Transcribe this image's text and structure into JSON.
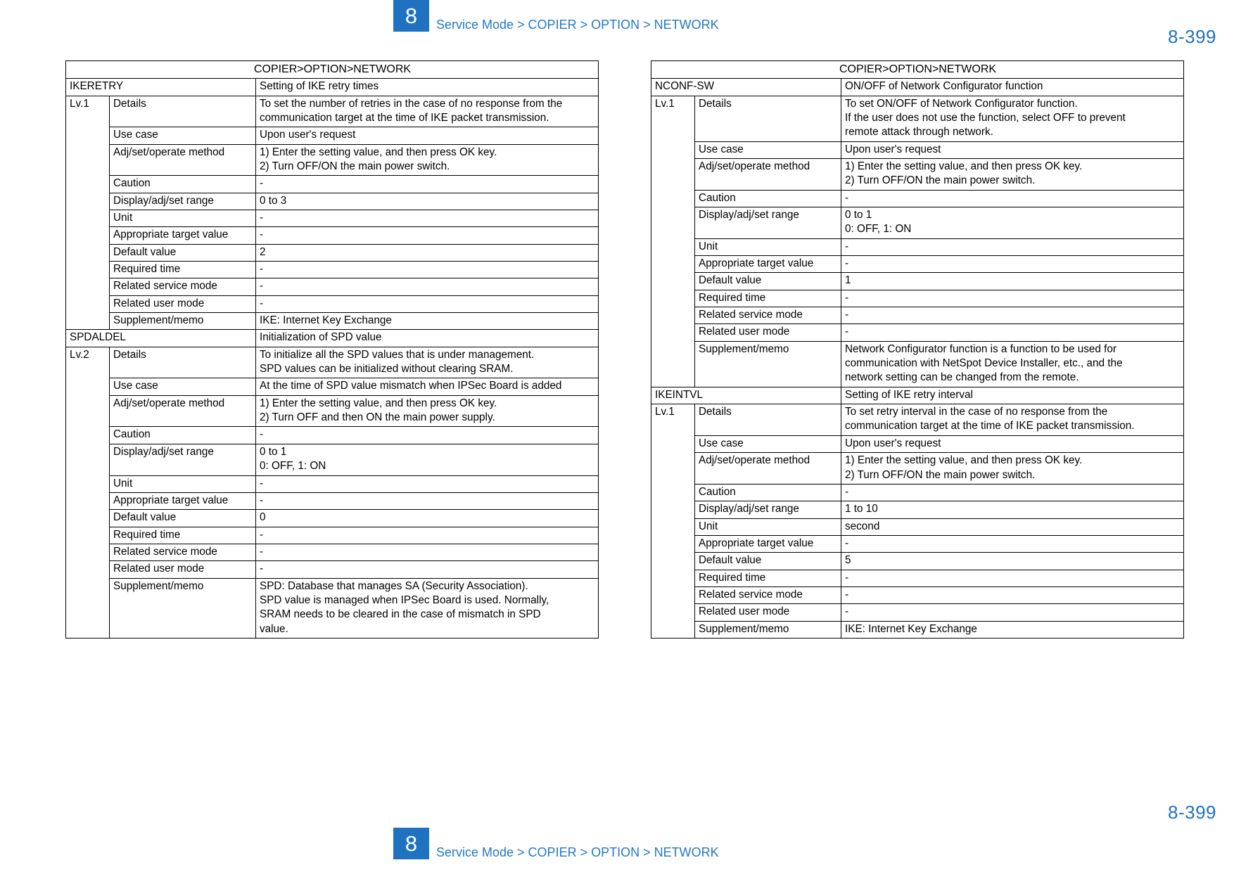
{
  "header": {
    "chapter": "8",
    "breadcrumb": "Service Mode > COPIER > OPTION > NETWORK",
    "page_number": "8-399"
  },
  "footer": {
    "chapter": "8",
    "breadcrumb": "Service Mode > COPIER > OPTION > NETWORK",
    "page_number": "8-399"
  },
  "colors": {
    "accent": "#1F72C0",
    "title_band": "#A7C0E4",
    "label_cell": "#D6DFF2"
  },
  "labels": {
    "details": "Details",
    "use_case": "Use case",
    "method": "Adj/set/operate method",
    "caution": "Caution",
    "range": "Display/adj/set range",
    "unit": "Unit",
    "target": "Appropriate target value",
    "default": "Default value",
    "required_time": "Required time",
    "related_service": "Related service mode",
    "related_user": "Related user mode",
    "supplement": "Supplement/memo"
  },
  "left_table": {
    "title": "COPIER>OPTION>NETWORK",
    "items": [
      {
        "code": "IKERETRY",
        "desc": "Setting of IKE retry times",
        "level": "Lv.1",
        "details": [
          "To set the number of retries in the case of no response from the",
          "communication target at the time of IKE packet transmission."
        ],
        "use_case": [
          "Upon user's request"
        ],
        "method": [
          "1) Enter the setting value, and then press OK key.",
          "2) Turn OFF/ON the main power switch."
        ],
        "caution": [
          "-"
        ],
        "range": [
          "0 to 3"
        ],
        "unit": [
          "-"
        ],
        "target": [
          "-"
        ],
        "default": [
          "2"
        ],
        "required_time": [
          "-"
        ],
        "related_service": [
          "-"
        ],
        "related_user": [
          "-"
        ],
        "supplement": [
          "IKE: Internet Key Exchange"
        ]
      },
      {
        "code": "SPDALDEL",
        "desc": "Initialization of SPD value",
        "level": "Lv.2",
        "details": [
          "To initialize all the SPD values that is under management.",
          "SPD values can be initialized without clearing SRAM."
        ],
        "use_case": [
          "At the time of SPD value mismatch when IPSec Board is added"
        ],
        "method": [
          "1) Enter the setting value, and then press OK key.",
          "2) Turn OFF and then ON the main power supply."
        ],
        "caution": [
          "-"
        ],
        "range": [
          "0 to 1",
          "0: OFF, 1: ON"
        ],
        "unit": [
          "-"
        ],
        "target": [
          "-"
        ],
        "default": [
          "0"
        ],
        "required_time": [
          "-"
        ],
        "related_service": [
          "-"
        ],
        "related_user": [
          "-"
        ],
        "supplement": [
          "SPD: Database that manages SA (Security Association).",
          "SPD value is managed when IPSec Board is used. Normally,",
          "SRAM needs to be cleared in the case of mismatch in SPD",
          "value."
        ]
      }
    ]
  },
  "right_table": {
    "title": "COPIER>OPTION>NETWORK",
    "items": [
      {
        "code": "NCONF-SW",
        "desc": "ON/OFF of Network Configurator function",
        "level": "Lv.1",
        "details": [
          "To set ON/OFF of Network Configurator function.",
          "If the user does not use the function, select OFF to prevent",
          "remote attack through network."
        ],
        "use_case": [
          "Upon user's request"
        ],
        "method": [
          "1) Enter the setting value, and then press OK key.",
          "2) Turn OFF/ON the main power switch."
        ],
        "caution": [
          "-"
        ],
        "range": [
          "0 to 1",
          "0: OFF, 1: ON"
        ],
        "unit": [
          "-"
        ],
        "target": [
          "-"
        ],
        "default": [
          "1"
        ],
        "required_time": [
          "-"
        ],
        "related_service": [
          "-"
        ],
        "related_user": [
          "-"
        ],
        "supplement": [
          "Network Configurator function is a function to be used for",
          "communication with NetSpot Device Installer, etc., and the",
          "network setting can be changed from the remote."
        ]
      },
      {
        "code": "IKEINTVL",
        "desc": "Setting of IKE retry interval",
        "level": "Lv.1",
        "details": [
          "To set retry interval in the case of no response from the",
          "communication target at the time of IKE packet transmission."
        ],
        "use_case": [
          "Upon user's request"
        ],
        "method": [
          "1) Enter the setting value, and then press OK key.",
          "2) Turn OFF/ON the main power switch."
        ],
        "caution": [
          "-"
        ],
        "range": [
          "1 to 10"
        ],
        "unit": [
          "second"
        ],
        "target": [
          "-"
        ],
        "default": [
          "5"
        ],
        "required_time": [
          "-"
        ],
        "related_service": [
          "-"
        ],
        "related_user": [
          "-"
        ],
        "supplement": [
          "IKE: Internet Key Exchange"
        ]
      }
    ]
  }
}
